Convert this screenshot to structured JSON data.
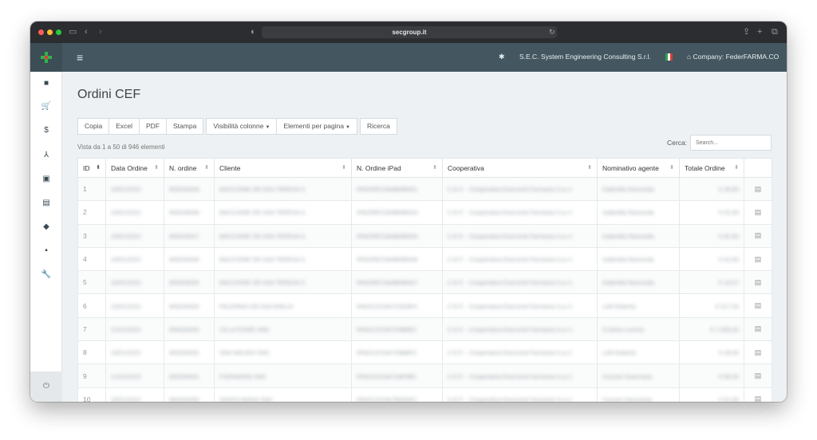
{
  "browser": {
    "url": "secgroup.it",
    "icons": [
      "sidebar-toggle-icon",
      "back-icon",
      "forward-icon",
      "shield-icon",
      "reload-icon",
      "share-icon",
      "new-tab-icon",
      "tabs-icon"
    ]
  },
  "appbar": {
    "company_name": "S.E.C. System Engineering Consulting S.r.l.",
    "company_label": "Company: FederFARMA.CO",
    "colors": {
      "bar": "#44565f",
      "logo_green": "#2fb34a",
      "logo_red": "#e03a3a"
    }
  },
  "sidebar": {
    "items": [
      {
        "icon": "dashboard-icon",
        "glyph": "■"
      },
      {
        "icon": "cart-icon",
        "glyph": "🛒"
      },
      {
        "icon": "dollar-icon",
        "glyph": "$"
      },
      {
        "icon": "network-icon",
        "glyph": "⅄"
      },
      {
        "icon": "briefcase-icon",
        "glyph": "▣"
      },
      {
        "icon": "file-icon",
        "glyph": "▤"
      },
      {
        "icon": "money-icon",
        "glyph": "◆"
      },
      {
        "icon": "box-icon",
        "glyph": "▪"
      },
      {
        "icon": "wrench-icon",
        "glyph": "🔧"
      }
    ],
    "power_icon": "⏻"
  },
  "page": {
    "title": "Ordini CEF",
    "toolbar": {
      "copy": "Copia",
      "excel": "Excel",
      "pdf": "PDF",
      "print": "Stampa",
      "columns": "Visibilità colonne",
      "per_page": "Elementi per pagina",
      "search_btn": "Ricerca"
    },
    "info": "Vista da 1 a 50 di 946 elementi",
    "search_label": "Cerca:",
    "search_placeholder": "Search..."
  },
  "table": {
    "headers": [
      "ID",
      "Data Ordine",
      "N. ordine",
      "Cliente",
      "N. Ordine iPad",
      "Cooperativa",
      "Nominativo agente",
      "Totale Ordine"
    ],
    "rows": [
      {
        "id": "1",
        "date": "24/01/2022",
        "num": "900026009",
        "client": "BACCIONE DR.SSA TERESA S",
        "ipad": "IPAD/RE/19A8B4B0A1",
        "coop": "C.E.F. - Cooperativa Esercenti Farmacia S.a.r.l.",
        "agent": "Gabriella Ramonda",
        "total": "€ 36,80"
      },
      {
        "id": "2",
        "date": "24/01/2022",
        "num": "900026008",
        "client": "BACCIONE DR.SSA TERESA S",
        "ipad": "IPAD/RE/19A8B4B0A3",
        "coop": "C.E.F. - Cooperativa Esercenti Farmacia S.a.r.l.",
        "agent": "Gabriella Ramonda",
        "total": "€ 52,90"
      },
      {
        "id": "3",
        "date": "24/01/2022",
        "num": "900026007",
        "client": "BACCIONE DR.SSA TERESA S",
        "ipad": "IPAD/RE/19A8B4B0A5",
        "coop": "C.E.F. - Cooperativa Esercenti Farmacia S.a.r.l.",
        "agent": "Gabriella Ramonda",
        "total": "€ 82,60"
      },
      {
        "id": "4",
        "date": "24/01/2022",
        "num": "900026006",
        "client": "BACCIONE DR.SSA TERESA S",
        "ipad": "IPAD/RE/19A8B4B0A6",
        "coop": "C.E.F. - Cooperativa Esercenti Farmacia S.a.r.l.",
        "agent": "Gabriella Ramonda",
        "total": "€ 62,90"
      },
      {
        "id": "5",
        "date": "24/01/2022",
        "num": "900026005",
        "client": "BACCIONE DR.SSA TERESA S",
        "ipad": "IPAD/RE/19A8B4B0A7",
        "coop": "C.E.F. - Cooperativa Esercenti Farmacia S.a.r.l.",
        "agent": "Gabriella Ramonda",
        "total": "€ 18,07"
      },
      {
        "id": "6",
        "date": "23/01/2022",
        "num": "900026004",
        "client": "PALERMO DR.SSA EMILIA",
        "ipad": "IPAD/LE/19A7C5D9F4",
        "coop": "C.E.F. - Cooperativa Esercenti Farmacia S.a.r.l.",
        "agent": "Lelli Roberto",
        "total": "€ 317,00"
      },
      {
        "id": "7",
        "date": "21/01/2022",
        "num": "900026003",
        "client": "VILLA FIORE SNC",
        "ipad": "IPAD/LE/19A7D9B8E1",
        "coop": "C.E.F. - Cooperativa Esercenti Farmacia S.a.r.l.",
        "agent": "Cristina Lorenzi",
        "total": "€ 1.058,00"
      },
      {
        "id": "8",
        "date": "20/01/2022",
        "num": "900026002",
        "client": "SAN MAURO SNC",
        "ipad": "IPAD/LE/19A7D8B8F2",
        "coop": "C.E.F. - Cooperativa Esercenti Farmacia S.a.r.l.",
        "agent": "Lelli Roberto",
        "total": "€ 28,90"
      },
      {
        "id": "9",
        "date": "21/01/2022",
        "num": "900026001",
        "client": "FORNARINI SNC",
        "ipad": "IPAD/LE/19A7D8F9B1",
        "coop": "C.E.F. - Cooperativa Esercenti Farmacia S.a.r.l.",
        "agent": "Cazzari Gianmaria",
        "total": "€ 89,00"
      },
      {
        "id": "10",
        "date": "20/01/2022",
        "num": "900026000",
        "client": "SANTA MARIA SNC",
        "ipad": "IPAD/LE/19A7B9D0E1",
        "coop": "C.E.F. - Cooperativa Esercenti Farmacia S.a.r.l.",
        "agent": "Cazzari Gianmaria",
        "total": "€ 52,90"
      }
    ]
  }
}
